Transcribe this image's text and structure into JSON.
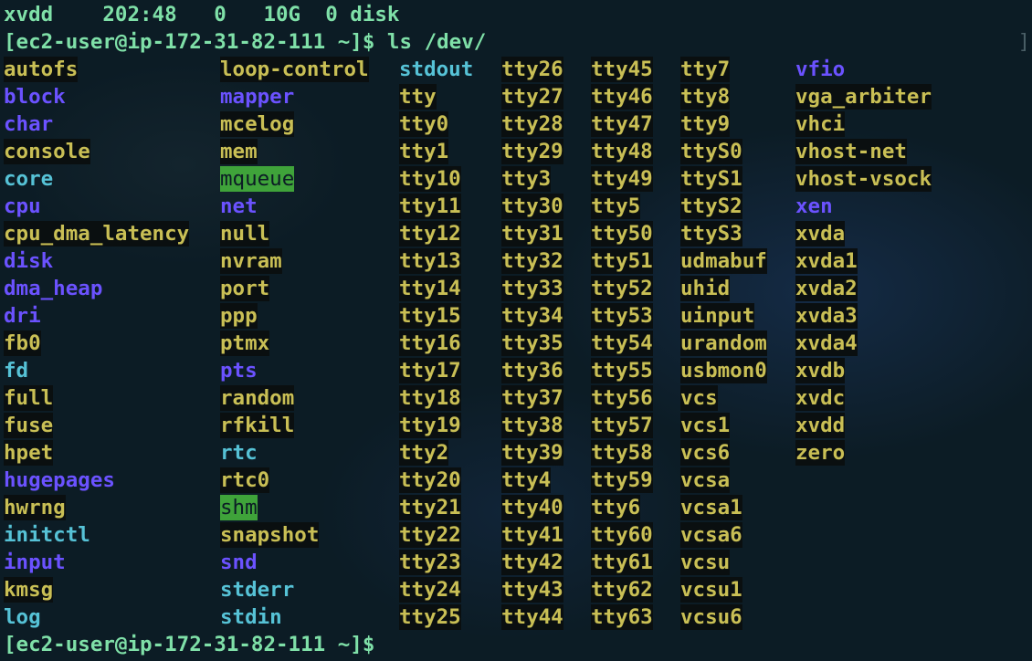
{
  "terminal": {
    "header_line": "xvdd    202:48   0   10G  0 disk",
    "command_prompt": "[ec2-user@ip-172-31-82-111 ~]$ ls /dev/",
    "final_prompt": "[ec2-user@ip-172-31-82-111 ~]$ ",
    "right_marker": "]"
  },
  "colors": {
    "background": "#0c1c25",
    "prompt_text": "#7fe0a8",
    "file_text": "#c9bf55",
    "directory_text": "#6b52ff",
    "symlink_text": "#56c2d6",
    "sticky_dir_background": "#3fa33a"
  },
  "listing": {
    "columns": [
      [
        {
          "name": "autofs",
          "type": "file"
        },
        {
          "name": "block",
          "type": "dir"
        },
        {
          "name": "char",
          "type": "dir"
        },
        {
          "name": "console",
          "type": "file"
        },
        {
          "name": "core",
          "type": "link"
        },
        {
          "name": "cpu",
          "type": "dir"
        },
        {
          "name": "cpu_dma_latency",
          "type": "file"
        },
        {
          "name": "disk",
          "type": "dir"
        },
        {
          "name": "dma_heap",
          "type": "dir"
        },
        {
          "name": "dri",
          "type": "dir"
        },
        {
          "name": "fb0",
          "type": "file"
        },
        {
          "name": "fd",
          "type": "link"
        },
        {
          "name": "full",
          "type": "file"
        },
        {
          "name": "fuse",
          "type": "file"
        },
        {
          "name": "hpet",
          "type": "file"
        },
        {
          "name": "hugepages",
          "type": "dir"
        },
        {
          "name": "hwrng",
          "type": "file"
        },
        {
          "name": "initctl",
          "type": "link"
        },
        {
          "name": "input",
          "type": "dir"
        },
        {
          "name": "kmsg",
          "type": "file"
        },
        {
          "name": "log",
          "type": "link"
        }
      ],
      [
        {
          "name": "loop-control",
          "type": "file"
        },
        {
          "name": "mapper",
          "type": "dir"
        },
        {
          "name": "mcelog",
          "type": "file"
        },
        {
          "name": "mem",
          "type": "file"
        },
        {
          "name": "mqueue",
          "type": "sticky"
        },
        {
          "name": "net",
          "type": "dir"
        },
        {
          "name": "null",
          "type": "file"
        },
        {
          "name": "nvram",
          "type": "file"
        },
        {
          "name": "port",
          "type": "file"
        },
        {
          "name": "ppp",
          "type": "file"
        },
        {
          "name": "ptmx",
          "type": "file"
        },
        {
          "name": "pts",
          "type": "dir"
        },
        {
          "name": "random",
          "type": "file"
        },
        {
          "name": "rfkill",
          "type": "file"
        },
        {
          "name": "rtc",
          "type": "link"
        },
        {
          "name": "rtc0",
          "type": "file"
        },
        {
          "name": "shm",
          "type": "sticky"
        },
        {
          "name": "snapshot",
          "type": "file"
        },
        {
          "name": "snd",
          "type": "dir"
        },
        {
          "name": "stderr",
          "type": "link"
        },
        {
          "name": "stdin",
          "type": "link"
        }
      ],
      [
        {
          "name": "stdout",
          "type": "link"
        },
        {
          "name": "tty",
          "type": "file"
        },
        {
          "name": "tty0",
          "type": "file"
        },
        {
          "name": "tty1",
          "type": "file"
        },
        {
          "name": "tty10",
          "type": "file"
        },
        {
          "name": "tty11",
          "type": "file"
        },
        {
          "name": "tty12",
          "type": "file"
        },
        {
          "name": "tty13",
          "type": "file"
        },
        {
          "name": "tty14",
          "type": "file"
        },
        {
          "name": "tty15",
          "type": "file"
        },
        {
          "name": "tty16",
          "type": "file"
        },
        {
          "name": "tty17",
          "type": "file"
        },
        {
          "name": "tty18",
          "type": "file"
        },
        {
          "name": "tty19",
          "type": "file"
        },
        {
          "name": "tty2",
          "type": "file"
        },
        {
          "name": "tty20",
          "type": "file"
        },
        {
          "name": "tty21",
          "type": "file"
        },
        {
          "name": "tty22",
          "type": "file"
        },
        {
          "name": "tty23",
          "type": "file"
        },
        {
          "name": "tty24",
          "type": "file"
        },
        {
          "name": "tty25",
          "type": "file"
        }
      ],
      [
        {
          "name": "tty26",
          "type": "file"
        },
        {
          "name": "tty27",
          "type": "file"
        },
        {
          "name": "tty28",
          "type": "file"
        },
        {
          "name": "tty29",
          "type": "file"
        },
        {
          "name": "tty3",
          "type": "file"
        },
        {
          "name": "tty30",
          "type": "file"
        },
        {
          "name": "tty31",
          "type": "file"
        },
        {
          "name": "tty32",
          "type": "file"
        },
        {
          "name": "tty33",
          "type": "file"
        },
        {
          "name": "tty34",
          "type": "file"
        },
        {
          "name": "tty35",
          "type": "file"
        },
        {
          "name": "tty36",
          "type": "file"
        },
        {
          "name": "tty37",
          "type": "file"
        },
        {
          "name": "tty38",
          "type": "file"
        },
        {
          "name": "tty39",
          "type": "file"
        },
        {
          "name": "tty4",
          "type": "file"
        },
        {
          "name": "tty40",
          "type": "file"
        },
        {
          "name": "tty41",
          "type": "file"
        },
        {
          "name": "tty42",
          "type": "file"
        },
        {
          "name": "tty43",
          "type": "file"
        },
        {
          "name": "tty44",
          "type": "file"
        }
      ],
      [
        {
          "name": "tty45",
          "type": "file"
        },
        {
          "name": "tty46",
          "type": "file"
        },
        {
          "name": "tty47",
          "type": "file"
        },
        {
          "name": "tty48",
          "type": "file"
        },
        {
          "name": "tty49",
          "type": "file"
        },
        {
          "name": "tty5",
          "type": "file"
        },
        {
          "name": "tty50",
          "type": "file"
        },
        {
          "name": "tty51",
          "type": "file"
        },
        {
          "name": "tty52",
          "type": "file"
        },
        {
          "name": "tty53",
          "type": "file"
        },
        {
          "name": "tty54",
          "type": "file"
        },
        {
          "name": "tty55",
          "type": "file"
        },
        {
          "name": "tty56",
          "type": "file"
        },
        {
          "name": "tty57",
          "type": "file"
        },
        {
          "name": "tty58",
          "type": "file"
        },
        {
          "name": "tty59",
          "type": "file"
        },
        {
          "name": "tty6",
          "type": "file"
        },
        {
          "name": "tty60",
          "type": "file"
        },
        {
          "name": "tty61",
          "type": "file"
        },
        {
          "name": "tty62",
          "type": "file"
        },
        {
          "name": "tty63",
          "type": "file"
        }
      ],
      [
        {
          "name": "tty7",
          "type": "file"
        },
        {
          "name": "tty8",
          "type": "file"
        },
        {
          "name": "tty9",
          "type": "file"
        },
        {
          "name": "ttyS0",
          "type": "file"
        },
        {
          "name": "ttyS1",
          "type": "file"
        },
        {
          "name": "ttyS2",
          "type": "file"
        },
        {
          "name": "ttyS3",
          "type": "file"
        },
        {
          "name": "udmabuf",
          "type": "file"
        },
        {
          "name": "uhid",
          "type": "file"
        },
        {
          "name": "uinput",
          "type": "file"
        },
        {
          "name": "urandom",
          "type": "file"
        },
        {
          "name": "usbmon0",
          "type": "file"
        },
        {
          "name": "vcs",
          "type": "file"
        },
        {
          "name": "vcs1",
          "type": "file"
        },
        {
          "name": "vcs6",
          "type": "file"
        },
        {
          "name": "vcsa",
          "type": "file"
        },
        {
          "name": "vcsa1",
          "type": "file"
        },
        {
          "name": "vcsa6",
          "type": "file"
        },
        {
          "name": "vcsu",
          "type": "file"
        },
        {
          "name": "vcsu1",
          "type": "file"
        },
        {
          "name": "vcsu6",
          "type": "file"
        }
      ],
      [
        {
          "name": "vfio",
          "type": "dir"
        },
        {
          "name": "vga_arbiter",
          "type": "file"
        },
        {
          "name": "vhci",
          "type": "file"
        },
        {
          "name": "vhost-net",
          "type": "file"
        },
        {
          "name": "vhost-vsock",
          "type": "file"
        },
        {
          "name": "xen",
          "type": "dir"
        },
        {
          "name": "xvda",
          "type": "file"
        },
        {
          "name": "xvda1",
          "type": "file"
        },
        {
          "name": "xvda2",
          "type": "file"
        },
        {
          "name": "xvda3",
          "type": "file"
        },
        {
          "name": "xvda4",
          "type": "file"
        },
        {
          "name": "xvdb",
          "type": "file"
        },
        {
          "name": "xvdc",
          "type": "file"
        },
        {
          "name": "xvdd",
          "type": "file"
        },
        {
          "name": "zero",
          "type": "file"
        }
      ]
    ]
  }
}
